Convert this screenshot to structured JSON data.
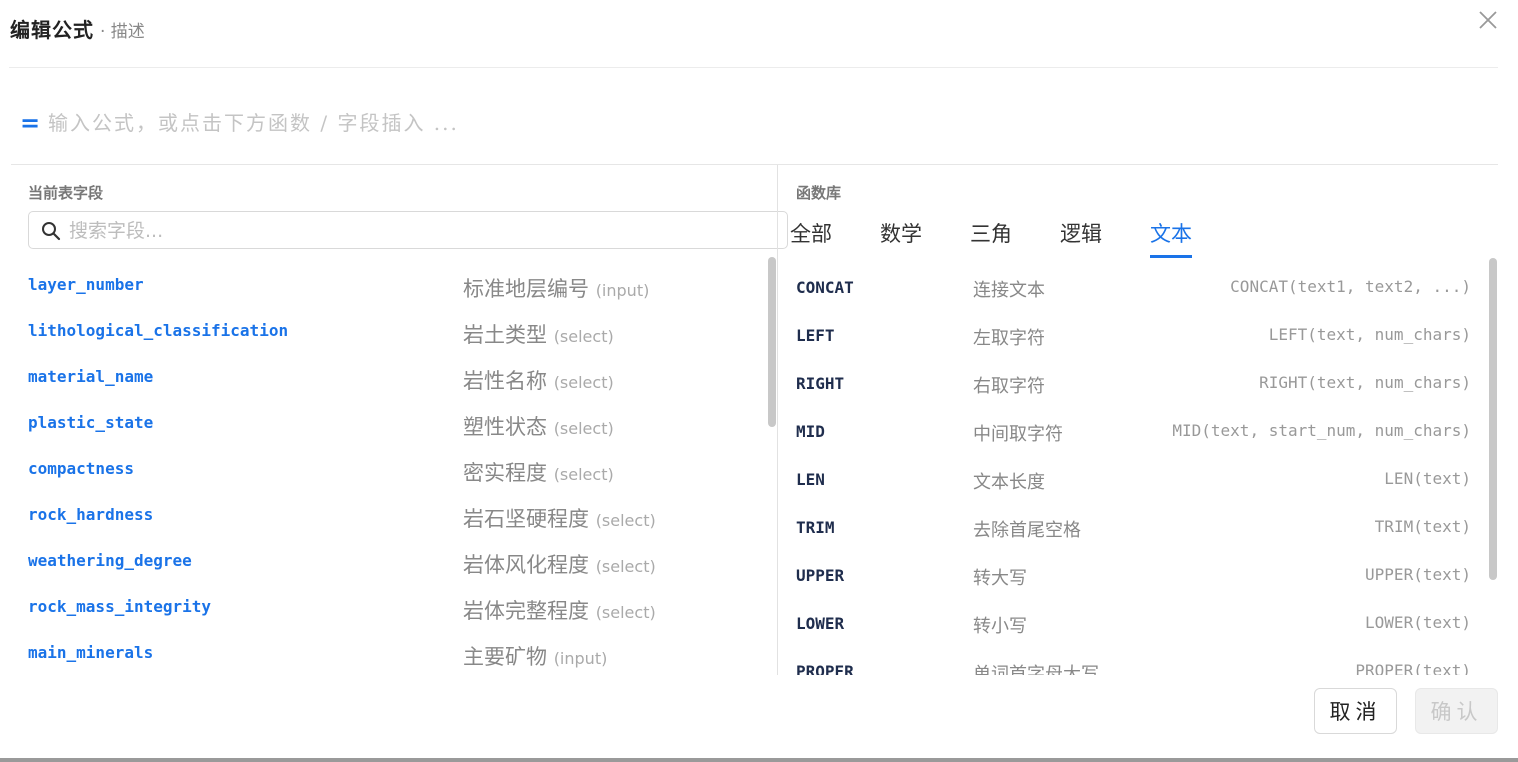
{
  "header": {
    "title": "编辑公式",
    "subtitle": "· 描述"
  },
  "formula": {
    "prefix": "=",
    "placeholder": "输入公式，或点击下方函数 / 字段插入 ...",
    "value": ""
  },
  "fields_panel": {
    "title": "当前表字段",
    "search_placeholder": "搜索字段...",
    "items": [
      {
        "name": "layer_number",
        "label": "标准地层编号",
        "type": "(input)"
      },
      {
        "name": "lithological_classification",
        "label": "岩土类型",
        "type": "(select)"
      },
      {
        "name": "material_name",
        "label": "岩性名称",
        "type": "(select)"
      },
      {
        "name": "plastic_state",
        "label": "塑性状态",
        "type": "(select)"
      },
      {
        "name": "compactness",
        "label": "密实程度",
        "type": "(select)"
      },
      {
        "name": "rock_hardness",
        "label": "岩石坚硬程度",
        "type": "(select)"
      },
      {
        "name": "weathering_degree",
        "label": "岩体风化程度",
        "type": "(select)"
      },
      {
        "name": "rock_mass_integrity",
        "label": "岩体完整程度",
        "type": "(select)"
      },
      {
        "name": "main_minerals",
        "label": "主要矿物",
        "type": "(input)"
      }
    ]
  },
  "functions_panel": {
    "title": "函数库",
    "tabs": [
      {
        "label": "全部"
      },
      {
        "label": "数学"
      },
      {
        "label": "三角"
      },
      {
        "label": "逻辑"
      },
      {
        "label": "文本"
      }
    ],
    "active_tab": "文本",
    "items": [
      {
        "name": "CONCAT",
        "desc": "连接文本",
        "signature": "CONCAT(text1, text2, ...)"
      },
      {
        "name": "LEFT",
        "desc": "左取字符",
        "signature": "LEFT(text, num_chars)"
      },
      {
        "name": "RIGHT",
        "desc": "右取字符",
        "signature": "RIGHT(text, num_chars)"
      },
      {
        "name": "MID",
        "desc": "中间取字符",
        "signature": "MID(text, start_num, num_chars)"
      },
      {
        "name": "LEN",
        "desc": "文本长度",
        "signature": "LEN(text)"
      },
      {
        "name": "TRIM",
        "desc": "去除首尾空格",
        "signature": "TRIM(text)"
      },
      {
        "name": "UPPER",
        "desc": "转大写",
        "signature": "UPPER(text)"
      },
      {
        "name": "LOWER",
        "desc": "转小写",
        "signature": "LOWER(text)"
      },
      {
        "name": "PROPER",
        "desc": "单词首字母大写",
        "signature": "PROPER(text)"
      }
    ]
  },
  "footer": {
    "cancel_label": "取消",
    "ok_label": "确认"
  },
  "colors": {
    "accent": "#1a73e8",
    "field_name": "#1a73e8",
    "func_name": "#1f2d4d",
    "muted": "#888888"
  },
  "icons": {
    "close": "close-icon",
    "search": "search-icon"
  }
}
